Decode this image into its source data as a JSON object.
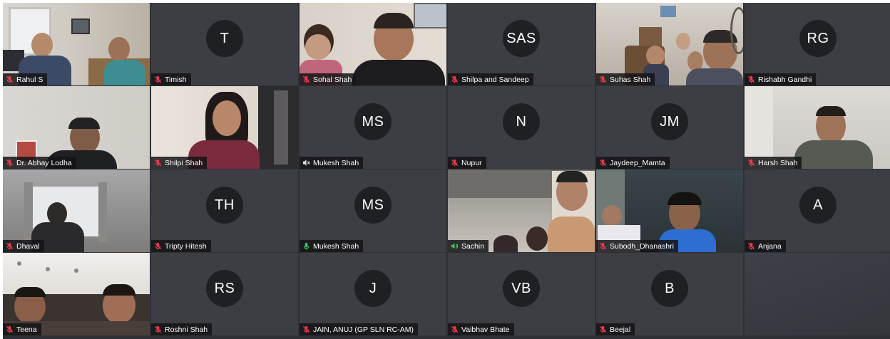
{
  "participants": [
    {
      "name": "Rahul S",
      "initials": "",
      "mic": "muted",
      "video": true
    },
    {
      "name": "Timish",
      "initials": "T",
      "mic": "muted",
      "video": false
    },
    {
      "name": "Sohal Shah",
      "initials": "",
      "mic": "muted",
      "video": true
    },
    {
      "name": "Shilpa and Sandeep",
      "initials": "SAS",
      "mic": "muted",
      "video": false
    },
    {
      "name": "Suhas Shah",
      "initials": "",
      "mic": "muted",
      "video": true
    },
    {
      "name": "Rishabh Gandhi",
      "initials": "RG",
      "mic": "muted",
      "video": false
    },
    {
      "name": "Dr. Abhay Lodha",
      "initials": "",
      "mic": "muted",
      "video": true
    },
    {
      "name": "Shilpi Shah",
      "initials": "",
      "mic": "muted",
      "video": true
    },
    {
      "name": "Mukesh Shah",
      "initials": "MS",
      "mic": "no-audio",
      "video": false
    },
    {
      "name": "Nupur",
      "initials": "N",
      "mic": "muted",
      "video": false
    },
    {
      "name": "Jaydeep_Mamta",
      "initials": "JM",
      "mic": "muted",
      "video": false
    },
    {
      "name": "Harsh Shah",
      "initials": "",
      "mic": "muted",
      "video": true
    },
    {
      "name": "Dhaval",
      "initials": "",
      "mic": "muted",
      "video": true
    },
    {
      "name": "Tripty Hitesh",
      "initials": "TH",
      "mic": "muted",
      "video": false
    },
    {
      "name": "Mukesh Shah",
      "initials": "MS",
      "mic": "active",
      "video": false
    },
    {
      "name": "Sachin",
      "initials": "",
      "mic": "speaking",
      "video": true
    },
    {
      "name": "Subodh_Dhanashri",
      "initials": "",
      "mic": "muted",
      "video": true
    },
    {
      "name": "Anjana",
      "initials": "A",
      "mic": "muted",
      "video": false
    },
    {
      "name": "Teena",
      "initials": "",
      "mic": "muted",
      "video": true
    },
    {
      "name": "Roshni Shah",
      "initials": "RS",
      "mic": "muted",
      "video": false
    },
    {
      "name": "JAIN, ANUJ (GP SLN RC-AM)",
      "initials": "J",
      "mic": "muted",
      "video": false
    },
    {
      "name": "Vaibhav Bhate",
      "initials": "VB",
      "mic": "muted",
      "video": false
    },
    {
      "name": "Beejal",
      "initials": "B",
      "mic": "muted",
      "video": false
    }
  ],
  "colors": {
    "muted_mic": "#e8394b",
    "active_mic": "#3ec35f",
    "tile_bg": "#3c3e44",
    "avatar_bg": "#1f2023"
  }
}
